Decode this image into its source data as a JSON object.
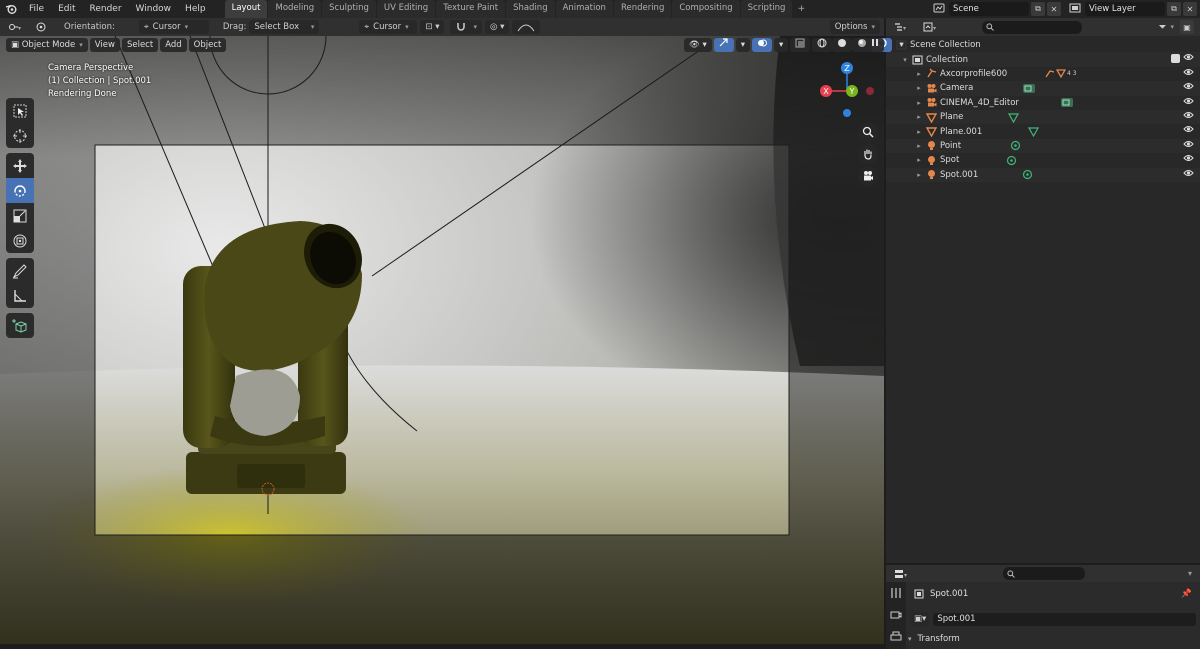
{
  "menu": {
    "items": [
      "File",
      "Edit",
      "Render",
      "Window",
      "Help"
    ]
  },
  "workspaces": {
    "tabs": [
      "Layout",
      "Modeling",
      "Sculpting",
      "UV Editing",
      "Texture Paint",
      "Shading",
      "Animation",
      "Rendering",
      "Compositing",
      "Scripting"
    ],
    "active": "Layout",
    "add_symbol": "+"
  },
  "top_right": {
    "scene": "Scene",
    "view_layer": "View Layer"
  },
  "viewport_header": {
    "orientation_label": "Orientation:",
    "orientation_value": "Cursor",
    "drag_label": "Drag:",
    "drag_value": "Select Box",
    "pivot_value": "Cursor",
    "options_label": "Options"
  },
  "viewport_header2": {
    "mode": "Object Mode",
    "view": "View",
    "select": "Select",
    "add": "Add",
    "object": "Object"
  },
  "viewport_overlay": {
    "line1": "Camera Perspective",
    "line2": "(1) Collection | Spot.001",
    "line3": "Rendering Done"
  },
  "gizmo": {
    "x": "X",
    "y": "Y",
    "z": "Z",
    "x_color": "#e8404f",
    "y_color": "#7ab51d",
    "z_color": "#2f83e0"
  },
  "outliner": {
    "root": "Scene Collection",
    "collection": "Collection",
    "items": [
      {
        "name": "Axcorprofile600",
        "type": "armature",
        "badge": "4 3"
      },
      {
        "name": "Camera",
        "type": "camera"
      },
      {
        "name": "CINEMA_4D_Editor",
        "type": "camera"
      },
      {
        "name": "Plane",
        "type": "mesh"
      },
      {
        "name": "Plane.001",
        "type": "mesh"
      },
      {
        "name": "Point",
        "type": "light"
      },
      {
        "name": "Spot",
        "type": "light"
      },
      {
        "name": "Spot.001",
        "type": "light"
      }
    ],
    "colors": {
      "object": "#e5874a",
      "data": "#3fb57a"
    }
  },
  "properties": {
    "object_name": "Spot.001",
    "data_name": "Spot.001",
    "section": "Transform"
  }
}
